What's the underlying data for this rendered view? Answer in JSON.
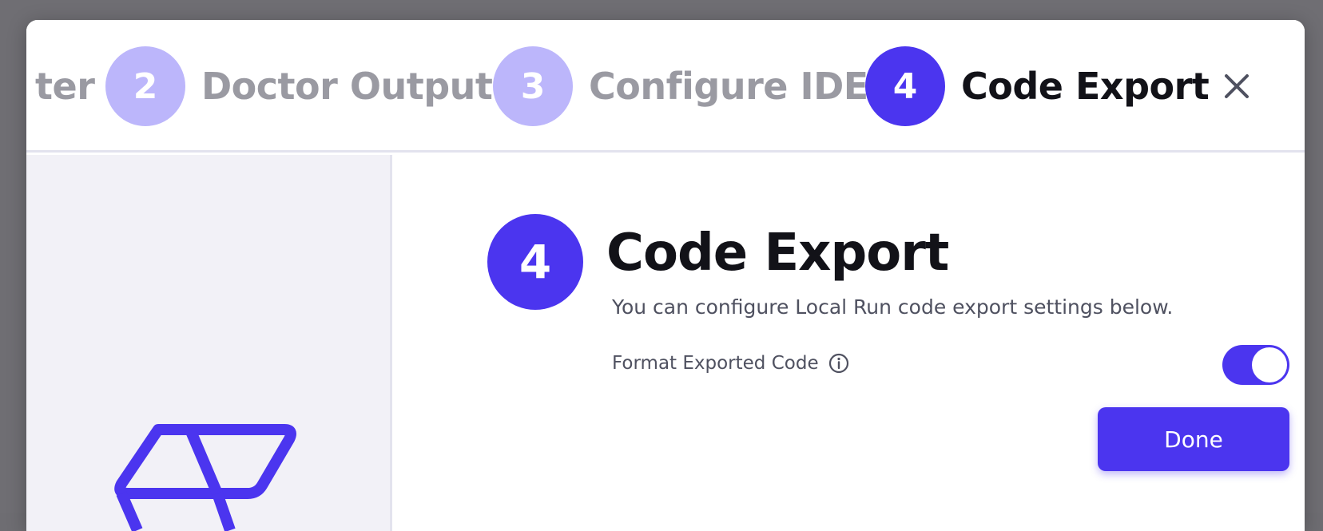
{
  "stepper": {
    "steps": [
      {
        "number": "",
        "label": "ter",
        "state": "inactive"
      },
      {
        "number": "2",
        "label": "Doctor Output",
        "state": "inactive"
      },
      {
        "number": "3",
        "label": "Configure IDE",
        "state": "inactive"
      },
      {
        "number": "4",
        "label": "Code Export",
        "state": "active"
      }
    ]
  },
  "main": {
    "step_number": "4",
    "title": "Code Export",
    "subtitle": "You can configure Local Run code export settings below.",
    "settings": [
      {
        "label": "Format Exported Code",
        "enabled": true
      }
    ],
    "done_label": "Done"
  },
  "colors": {
    "accent": "#4b35ef",
    "step_inactive": "#bcb6fb",
    "sidebar_bg": "#f2f1f7"
  },
  "icons": {
    "close": "close-icon",
    "info": "info-icon",
    "logo": "app-logo"
  }
}
